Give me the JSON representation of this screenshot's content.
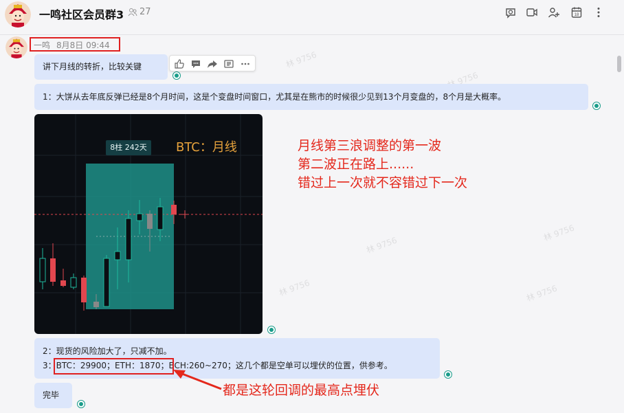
{
  "header": {
    "title": "一鸣社区会员群3",
    "member_count": "27"
  },
  "message": {
    "sender": "一鸣",
    "time": "8月8日 09:44",
    "lines": {
      "l1": "讲下月线的转折，比较关键",
      "l2": "1：大饼从去年底反弹已经是8个月时间，这是个变盘时间窗口，尤其是在熊市的时候很少见到13个月变盘的，8个月是大概率。",
      "l3": "2：现货的风险加大了，只减不加。",
      "l4_prefix": "3：",
      "l4_highlight": "BTC：29900；ETH：1870；",
      "l4_rest": "BCH:260~270；这几个都是空单可以埋伏的位置，供参考。",
      "l5": "完毕"
    }
  },
  "chart_image": {
    "label_box": "8柱  242天",
    "title": "BTC：月线",
    "colors": {
      "background": "#0b0e13",
      "up": "#1fb89e",
      "down": "#e2474f",
      "highlight": "#1f8f88",
      "title": "#e6a23c"
    }
  },
  "annotations": {
    "line1": "月线第三浪调整的第一波",
    "line2": "第二波正在路上......",
    "line3": "错过上一次就不容错过下一次",
    "arrow_text": "都是这轮回调的最高点埋伏"
  },
  "watermark": "林 9756"
}
